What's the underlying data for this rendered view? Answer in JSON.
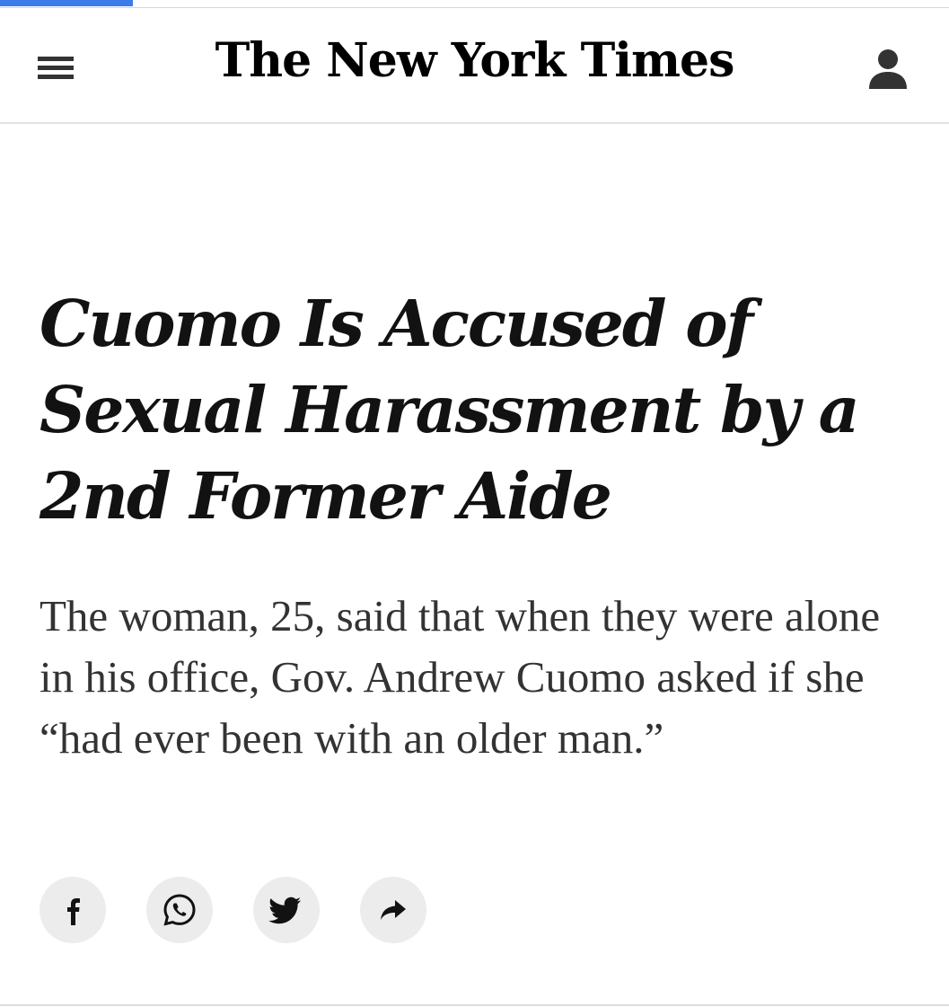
{
  "page_load": {
    "progress": 0.14
  },
  "masthead": {
    "logo_text": "The New York Times",
    "menu_icon": "hamburger-menu-icon",
    "account_icon": "user-account-icon"
  },
  "article": {
    "headline": "Cuomo Is Accused of Sexual Harassment by a 2nd Former Aide",
    "summary": "The woman, 25, said that when they were alone in his office, Gov. Andrew Cuomo asked if she “had ever been with an older man.”"
  },
  "share": {
    "buttons": [
      {
        "id": "facebook",
        "icon": "facebook-icon"
      },
      {
        "id": "whatsapp",
        "icon": "whatsapp-icon"
      },
      {
        "id": "twitter",
        "icon": "twitter-icon"
      },
      {
        "id": "more",
        "icon": "share-arrow-icon"
      }
    ]
  },
  "colors": {
    "load_bar": "#3b7ce8",
    "button_bg": "#ececec",
    "text_primary": "#121212",
    "text_secondary": "#333333"
  }
}
